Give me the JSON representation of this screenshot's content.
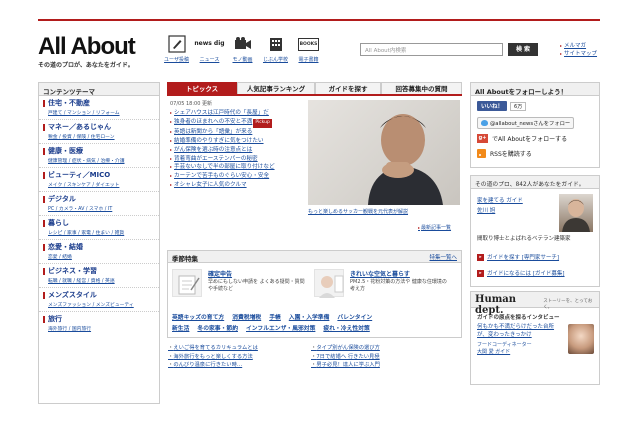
{
  "header": {
    "logo": "All About",
    "tagline": "その道のプロが、あなたをガイド。",
    "icons": [
      {
        "name": "pen-icon",
        "label": "ユーザ投稿"
      },
      {
        "name": "news-dig-icon",
        "label": "ニュース",
        "badge": "news dig"
      },
      {
        "name": "camera-icon",
        "label": "モノ動画"
      },
      {
        "name": "building-icon",
        "label": "じぶん学校"
      },
      {
        "name": "book-icon",
        "label": "電子書籍",
        "badge": "BOOKS"
      }
    ],
    "search_placeholder": "All About内検索",
    "search_button": "検 索",
    "top_links": [
      "メルマガ",
      "サイトマップ"
    ]
  },
  "sidebar": {
    "title": "コンテンツテーマ",
    "categories": [
      {
        "label": "住宅・不動産",
        "sub": "戸建て / マンション / リフォーム"
      },
      {
        "label": "マネー／あるじゃん",
        "sub": "税金 / 投資 / 保険 / 住宅ローン"
      },
      {
        "label": "健康・医療",
        "sub": "健康管理 / 症状・病気 / 治療・介護"
      },
      {
        "label": "ビューティ／MICO",
        "sub": "メイク / スキンケア / ダイエット"
      },
      {
        "label": "デジタル",
        "sub": "PC / カメラ・AV / スマホ / IT"
      },
      {
        "label": "暮らし",
        "sub": "レシピ / 家事 / 家電 / 住まい / 雑貨"
      },
      {
        "label": "恋愛・結婚",
        "sub": "恋愛 / 結婚"
      },
      {
        "label": "ビジネス・学習",
        "sub": "転職 / 就職 / 経営 / 資格 / 英語"
      },
      {
        "label": "メンズスタイル",
        "sub": "メンズファッション / メンズビューティ"
      },
      {
        "label": "旅行",
        "sub": "海外旅行 / 国内旅行"
      }
    ]
  },
  "tabs": [
    "トピックス",
    "人気記事ランキング",
    "ガイドを探す",
    "回答募集中の質問"
  ],
  "topics": {
    "date": "07/05 18:00 更新",
    "items": [
      "シェアハウスは江戸時代の「長屋」だ",
      "独身者のほまれへの不安と不満",
      "英語は新聞から「語彙」が来る",
      "結婚準備のやりすぎに気をつけたい",
      "がん保険を選ぶ時の注意点とは",
      "背着弯曲がエーステンパーの秘密",
      "手芸ないなしで半の部屋に取り付けなど",
      "カーテンで苦手ものぐらい安心・安全",
      "オシャレ女子に人気のクルマ"
    ],
    "pickup_label": "Pickup",
    "hero_caption": "もっと楽しめるサッカー観戦を元代表が解説",
    "more_label": "最新記事一覧"
  },
  "season": {
    "title": "季節特集",
    "list_label": "特集一覧へ",
    "items": [
      {
        "title": "確定申告",
        "desc": "早めにもしない申請を よくある疑問・質問や手続など"
      },
      {
        "title": "きれいな空気と暮らす",
        "desc": "PM2.5・花粉対策の方法や 健康な住環境の考え方"
      }
    ],
    "keywords_row1": [
      "英語キッズの育て方",
      "消費税増税",
      "手帳",
      "入園・入学準備",
      "バレンタイン"
    ],
    "keywords_row2": [
      "新生活",
      "冬の家事・節約",
      "インフルエンザ・風邪対策",
      "疲れ・冷え性対策"
    ]
  },
  "bottom_links": {
    "left": [
      "えいご得を育てるカリキュラムとは",
      "海外旅行をもっと楽しくする方法",
      "のんびり温泉に行きたい時…"
    ],
    "right": [
      "タイプ別がん保険の選び方",
      "7日で結婚へ 行きたい見極",
      "男子必見！達人に学ぶ入門"
    ]
  },
  "follow": {
    "title": "All Aboutをフォローしよう！",
    "fb_label": "いいね！",
    "fb_count": "6万",
    "twitter_label": "@allabout_newsさんをフォロー",
    "gplus_label": "でAll Aboutをフォローする",
    "gplus_badge": "g+",
    "rss_label": "RSSを購読する"
  },
  "guide": {
    "title": "その道のプロ、842人があなたをガイド。",
    "lines": [
      "家を建てる ガイド",
      "佐川 旭"
    ],
    "desc": "間取り博士とよばれるベテラン建築家",
    "link1": "ガイドを探す [専門家サーチ]",
    "link2": "ガイドになるには [ガイド募集]"
  },
  "human": {
    "title": "Human dept.",
    "subtitle": "ストーリーを、とっておく。",
    "heading": "ガイドの原点を探るインタビュー",
    "link": "何もかも不満だらけだった台所が、変わったきっかけ",
    "name_lines": [
      "フードコーディネーター",
      "大関 愛 ガイド"
    ]
  },
  "colors": {
    "accent": "#b21c1c",
    "link": "#1a4c9c",
    "facebook": "#3b5998",
    "gplus": "#d64937",
    "rss": "#f28a1a"
  }
}
